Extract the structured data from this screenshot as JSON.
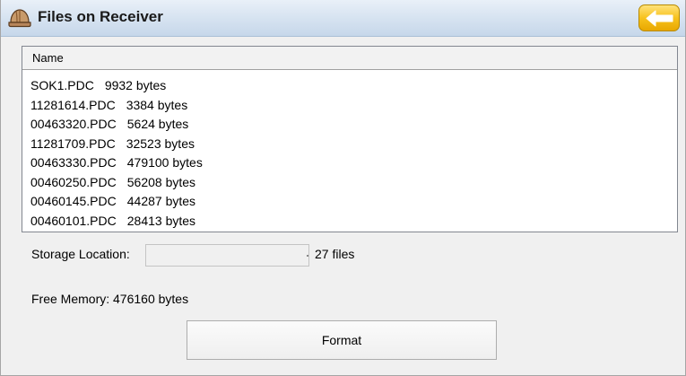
{
  "window": {
    "title": "Files on Receiver",
    "icons": {
      "app": "hard-hat-icon",
      "back": "arrow-left-icon"
    },
    "colors": {
      "back_button": "#f7c21e",
      "titlebar": "#d5e2f0"
    }
  },
  "file_list": {
    "column_header": "Name",
    "files": [
      {
        "name": "SOK1.PDC",
        "size": "9932 bytes"
      },
      {
        "name": "11281614.PDC",
        "size": "3384 bytes"
      },
      {
        "name": "00463320.PDC",
        "size": "5624 bytes"
      },
      {
        "name": "11281709.PDC",
        "size": "32523 bytes"
      },
      {
        "name": "00463330.PDC",
        "size": "479100 bytes"
      },
      {
        "name": "00460250.PDC",
        "size": "56208 bytes"
      },
      {
        "name": "00460145.PDC",
        "size": "44287 bytes"
      },
      {
        "name": "00460101.PDC",
        "size": "28413 bytes"
      }
    ]
  },
  "storage": {
    "label": "Storage Location:",
    "selected_value": "",
    "file_count": "27 files"
  },
  "memory": {
    "free_text": "Free Memory: 476160 bytes"
  },
  "actions": {
    "format_label": "Format"
  }
}
